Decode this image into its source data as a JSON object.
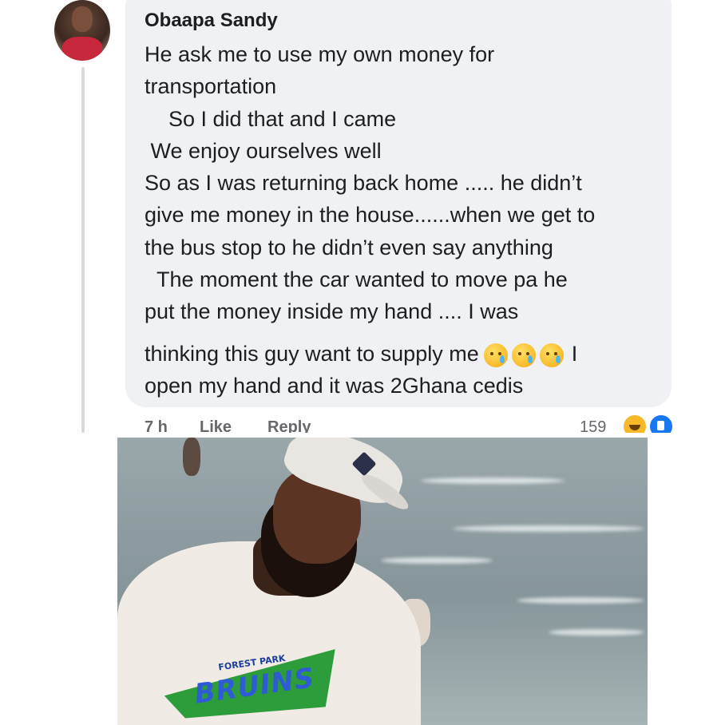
{
  "comment": {
    "author": "Obaapa Sandy",
    "lines": [
      "He ask me to use my own money for",
      "transportation",
      "    So I did that and I came",
      " We enjoy ourselves well",
      "So as I was returning back home ..... he didn’t",
      "give me money in the house......when we get to",
      "the bus stop to he didn’t even say anything",
      "  The moment the car wanted to move pa he",
      "put the money inside my hand .... I was"
    ],
    "line_with_emoji_before": "thinking this guy want to supply me",
    "line_with_emoji_after": "I",
    "last_line": "open my hand and it was 2Ghana cedis",
    "emoji_icons": [
      "crying-face-icon",
      "crying-face-icon",
      "crying-face-icon"
    ],
    "time": "7 h",
    "like_label": "Like",
    "reply_label": "Reply",
    "reaction_count": "159",
    "reaction_icons": [
      "haha-reaction-icon",
      "like-reaction-icon"
    ]
  },
  "photo": {
    "shirt_text": "BRUINS",
    "shirt_subtext": "FOREST PARK"
  },
  "colors": {
    "bubble": "#eff1f4",
    "text": "#1c1e21",
    "muted": "#65676b",
    "like_blue": "#1877f2"
  }
}
